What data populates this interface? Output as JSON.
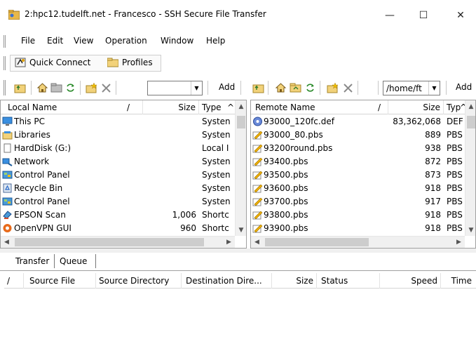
{
  "window": {
    "title": "2:hpc12.tudelft.net - Francesco - SSH Secure File Transfer",
    "minimize": "—",
    "maximize": "☐",
    "close": "✕"
  },
  "menu": {
    "items": [
      {
        "label": "File"
      },
      {
        "label": "Edit"
      },
      {
        "label": "View"
      },
      {
        "label": "Operation"
      },
      {
        "label": "Window"
      },
      {
        "label": "Help"
      }
    ]
  },
  "quickbar": {
    "quick_connect": "Quick Connect",
    "profiles": "Profiles"
  },
  "toolbar": {
    "left_combo_value": "",
    "left_add": "Add",
    "right_combo_value": "/home/ft",
    "right_add": "Add"
  },
  "local": {
    "columns": {
      "name": "Local Name",
      "sort": "/",
      "size": "Size",
      "type": "Type",
      "arrow": "^"
    },
    "rows": [
      {
        "icon": "computer-icon",
        "name": "This PC",
        "size": "",
        "type": "Systen"
      },
      {
        "icon": "libraries-icon",
        "name": "Libraries",
        "size": "",
        "type": "Systen"
      },
      {
        "icon": "drive-icon",
        "name": "HardDisk (G:)",
        "size": "",
        "type": "Local I"
      },
      {
        "icon": "network-icon",
        "name": "Network",
        "size": "",
        "type": "Systen"
      },
      {
        "icon": "control-panel-icon",
        "name": "Control Panel",
        "size": "",
        "type": "Systen"
      },
      {
        "icon": "recycle-bin-icon",
        "name": "Recycle Bin",
        "size": "",
        "type": "Systen"
      },
      {
        "icon": "control-panel-icon",
        "name": "Control Panel",
        "size": "",
        "type": "Systen"
      },
      {
        "icon": "scanner-icon",
        "name": "EPSON Scan",
        "size": "1,006",
        "type": "Shortc"
      },
      {
        "icon": "openvpn-icon",
        "name": "OpenVPN GUI",
        "size": "960",
        "type": "Shortc"
      }
    ]
  },
  "remote": {
    "columns": {
      "name": "Remote Name",
      "sort": "/",
      "size": "Size",
      "type": "Typ",
      "arrow": "^"
    },
    "rows": [
      {
        "icon": "def-file-icon",
        "name": "93000_120fc.def",
        "size": "83,362,068",
        "type": "DEF"
      },
      {
        "icon": "pbs-file-icon",
        "name": "93000_80.pbs",
        "size": "889",
        "type": "PBS"
      },
      {
        "icon": "pbs-file-icon",
        "name": "93200round.pbs",
        "size": "938",
        "type": "PBS"
      },
      {
        "icon": "pbs-file-icon",
        "name": "93400.pbs",
        "size": "872",
        "type": "PBS"
      },
      {
        "icon": "pbs-file-icon",
        "name": "93500.pbs",
        "size": "873",
        "type": "PBS"
      },
      {
        "icon": "pbs-file-icon",
        "name": "93600.pbs",
        "size": "918",
        "type": "PBS"
      },
      {
        "icon": "pbs-file-icon",
        "name": "93700.pbs",
        "size": "917",
        "type": "PBS"
      },
      {
        "icon": "pbs-file-icon",
        "name": "93800.pbs",
        "size": "918",
        "type": "PBS"
      },
      {
        "icon": "pbs-file-icon",
        "name": "93900.pbs",
        "size": "918",
        "type": "PBS"
      }
    ]
  },
  "bottom": {
    "tabs": [
      {
        "label": "Transfer"
      },
      {
        "label": "Queue"
      }
    ],
    "columns": {
      "sort": "/",
      "source_file": "Source File",
      "source_directory": "Source Directory",
      "destination": "Destination Dire...",
      "size": "Size",
      "status": "Status",
      "speed": "Speed",
      "time": "Time"
    }
  }
}
